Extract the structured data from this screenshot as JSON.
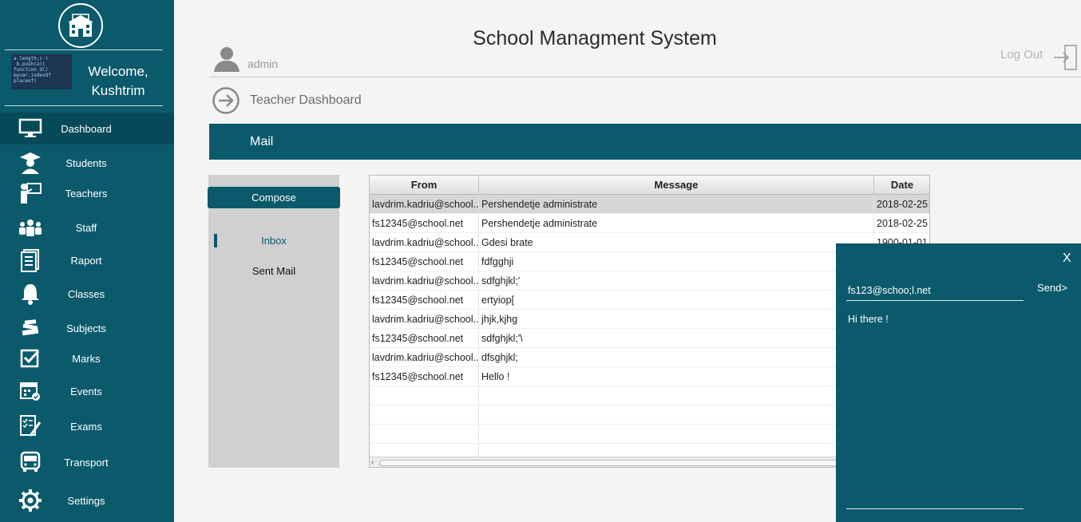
{
  "sidebar": {
    "welcome": "Welcome, Kushtrim",
    "avatar_code": "a.length;c-)\n b.push(a)(\nfunction d()\nmyvar.indexOf\nplaceof(",
    "items": [
      {
        "label": "Dashboard",
        "icon": "monitor-icon",
        "active": true
      },
      {
        "label": "Students",
        "icon": "student-icon"
      },
      {
        "label": "Teachers",
        "icon": "teacher-icon"
      },
      {
        "label": "Staff",
        "icon": "staff-icon"
      },
      {
        "label": "Raport",
        "icon": "report-icon"
      },
      {
        "label": "Classes",
        "icon": "bell-icon"
      },
      {
        "label": "Subjects",
        "icon": "books-icon"
      },
      {
        "label": "Marks",
        "icon": "checkbox-icon"
      },
      {
        "label": "Events",
        "icon": "calendar-icon"
      },
      {
        "label": "Exams",
        "icon": "exam-icon"
      },
      {
        "label": "Transport",
        "icon": "bus-icon"
      },
      {
        "label": "Settings",
        "icon": "gear-icon"
      }
    ]
  },
  "header": {
    "title": "School Managment System",
    "user": "admin",
    "logout": "Log Out",
    "dashboard_title": "Teacher Dashboard",
    "section": "Mail"
  },
  "mail_nav": {
    "compose": "Compose",
    "inbox": "Inbox",
    "sent": "Sent Mail"
  },
  "table": {
    "columns": [
      "From",
      "Message",
      "Date"
    ],
    "rows": [
      [
        "lavdrim.kadriu@school...",
        "Pershendetje administrate",
        "2018-02-25"
      ],
      [
        "fs12345@school.net",
        "Pershendetje administrate",
        "2018-02-25"
      ],
      [
        "lavdrim.kadriu@school...",
        "Gdesi  brate",
        "1900-01-01"
      ],
      [
        "fs12345@school.net",
        "fdfgghji",
        ""
      ],
      [
        "lavdrim.kadriu@school...",
        "sdfghjkl;'",
        ""
      ],
      [
        "fs12345@school.net",
        "ertyiop[",
        ""
      ],
      [
        "lavdrim.kadriu@school...",
        "jhjk,kjhg",
        ""
      ],
      [
        "fs12345@school.net",
        "sdfghjkl;'\\",
        ""
      ],
      [
        "lavdrim.kadriu@school...",
        "dfsghjkl;",
        ""
      ],
      [
        "fs12345@school.net",
        "Hello !",
        ""
      ]
    ]
  },
  "compose_panel": {
    "close": "X",
    "to": "fs123@schoo;l.net",
    "send": "Send>",
    "message": "Hi there !"
  },
  "colors": {
    "primary": "#0b5a6c",
    "active": "#064a59",
    "background": "#f4f4f4"
  }
}
